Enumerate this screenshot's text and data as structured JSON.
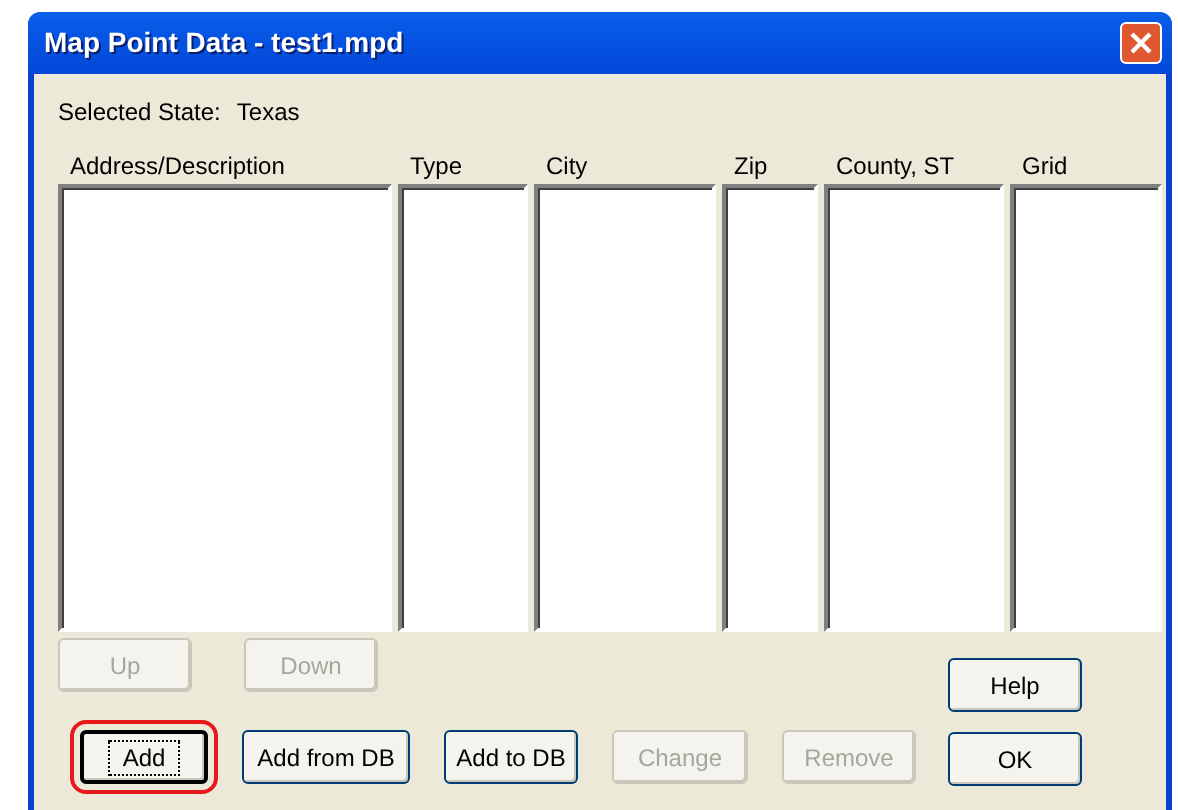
{
  "window": {
    "title": "Map Point Data - test1.mpd"
  },
  "selected_state": {
    "label": "Selected State:",
    "value": "Texas"
  },
  "columns": [
    {
      "label": "Address/Description"
    },
    {
      "label": "Type"
    },
    {
      "label": "City"
    },
    {
      "label": "Zip"
    },
    {
      "label": "County, ST"
    },
    {
      "label": "Grid"
    }
  ],
  "nav_buttons": [
    {
      "label": "Up",
      "disabled": true,
      "highlighted": false
    },
    {
      "label": "Down",
      "disabled": true,
      "highlighted": false
    }
  ],
  "action_buttons": [
    {
      "label": "Add",
      "disabled": false,
      "highlighted": true
    },
    {
      "label": "Add from DB",
      "disabled": false,
      "highlighted": false
    },
    {
      "label": "Add to DB",
      "disabled": false,
      "highlighted": false
    },
    {
      "label": "Change",
      "disabled": true,
      "highlighted": false
    },
    {
      "label": "Remove",
      "disabled": true,
      "highlighted": false
    }
  ],
  "side_buttons": [
    {
      "label": "Help",
      "disabled": false,
      "highlighted": false
    },
    {
      "label": "OK",
      "disabled": false,
      "highlighted": false
    }
  ]
}
